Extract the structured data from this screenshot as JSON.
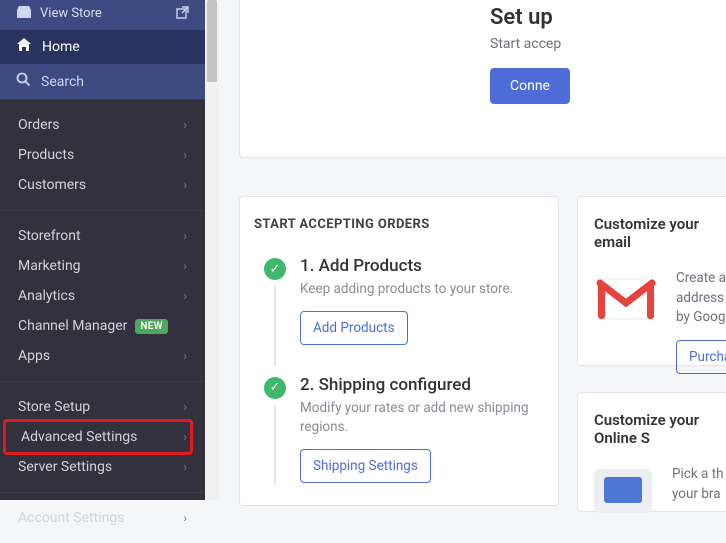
{
  "sidebar": {
    "view_store": "View Store",
    "home": "Home",
    "search": "Search",
    "group1": [
      "Orders",
      "Products",
      "Customers"
    ],
    "group2": [
      "Storefront",
      "Marketing",
      "Analytics",
      "Channel Manager",
      "Apps"
    ],
    "group2_badges": {
      "3": "NEW"
    },
    "group3": [
      "Store Setup",
      "Advanced Settings",
      "Server Settings"
    ],
    "group4": [
      "Account Settings"
    ]
  },
  "setup": {
    "title": "Set up",
    "subtitle": "Start accep",
    "button": "Conne"
  },
  "orders_card": {
    "heading": "START ACCEPTING ORDERS",
    "steps": [
      {
        "title": "1. Add Products",
        "desc": "Keep adding products to your store.",
        "button": "Add Products"
      },
      {
        "title": "2. Shipping configured",
        "desc": "Modify your rates or add new shipping regions.",
        "button": "Shipping Settings"
      }
    ]
  },
  "email_card": {
    "heading": "Customize your email",
    "desc": "Create a business email address that matches your brand, powered by Google",
    "desc_short": "Create a\naddress t\nby Googl",
    "button": "Purcha"
  },
  "store_card": {
    "heading": "Customize your Online S",
    "desc": "Pick a th\nyour bra"
  }
}
